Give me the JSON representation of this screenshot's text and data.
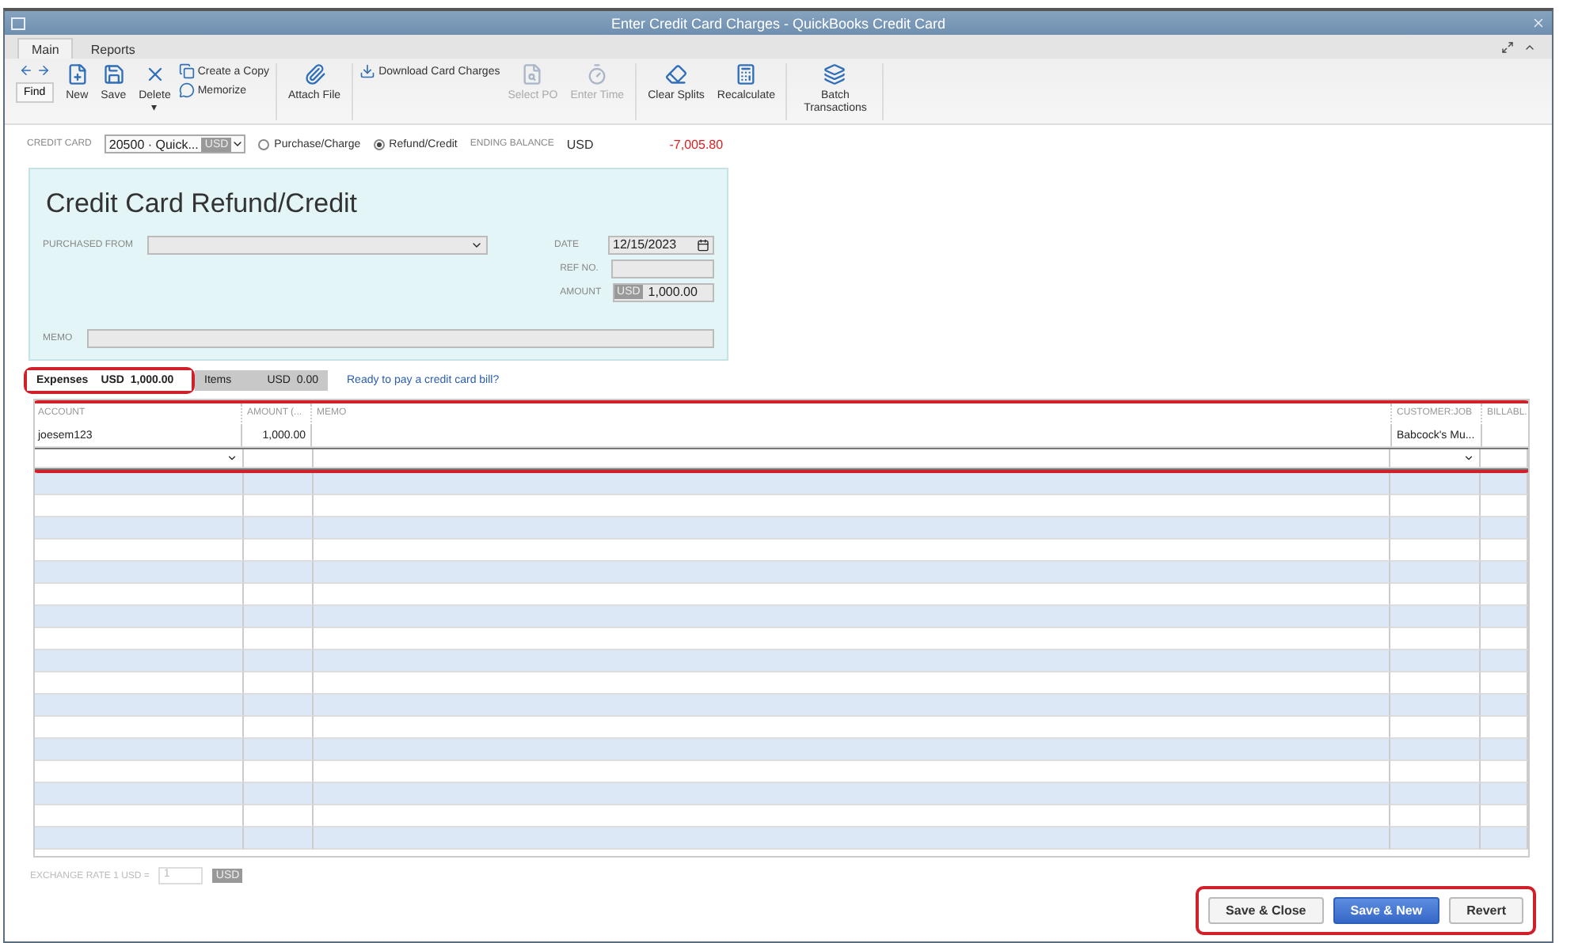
{
  "window": {
    "title": "Enter Credit Card Charges - QuickBooks Credit Card"
  },
  "ribbon_tabs": [
    {
      "label": "Main",
      "selected": true
    },
    {
      "label": "Reports",
      "selected": false
    }
  ],
  "toolbar": [
    {
      "kind": "find",
      "label": "Find"
    },
    {
      "kind": "big",
      "label": "New",
      "disabled": false
    },
    {
      "kind": "big",
      "label": "Save",
      "disabled": false
    },
    {
      "kind": "big",
      "label": "Delete",
      "disabled": false,
      "caret": "▾"
    },
    {
      "kind": "pair",
      "items": [
        {
          "label": "Create a Copy"
        },
        {
          "label": "Memorize"
        }
      ]
    },
    {
      "kind": "sep"
    },
    {
      "kind": "big",
      "label": "Attach File",
      "disabled": false
    },
    {
      "kind": "sep"
    },
    {
      "kind": "wide",
      "label": "Download Card Charges"
    },
    {
      "kind": "big",
      "label": "Select PO",
      "disabled": true
    },
    {
      "kind": "big",
      "label": "Enter Time",
      "disabled": true
    },
    {
      "kind": "sep"
    },
    {
      "kind": "big",
      "label": "Clear Splits",
      "disabled": false
    },
    {
      "kind": "big",
      "label": "Recalculate",
      "disabled": false
    },
    {
      "kind": "sep"
    },
    {
      "kind": "big",
      "label": "Batch Transactions",
      "disabled": false
    },
    {
      "kind": "sep"
    }
  ],
  "header": {
    "credit_card_label": "CREDIT CARD",
    "credit_card": "20500 · Quick...",
    "currency": "USD",
    "types": [
      {
        "label": "Purchase/Charge",
        "selected": false
      },
      {
        "label": "Refund/Credit",
        "selected": true
      }
    ],
    "ending_balance_label": "ENDING BALANCE",
    "ending_currency": "USD",
    "ending_balance": "-7,005.80"
  },
  "form": {
    "title": "Credit Card Refund/Credit",
    "purchased_from_label": "PURCHASED FROM",
    "date_label": "DATE",
    "date": "12/15/2023",
    "ref_label": "REF NO.",
    "amount_label": "AMOUNT",
    "amount_currency": "USD",
    "amount": "1,000.00",
    "memo_label": "MEMO"
  },
  "detail_tabs": [
    {
      "label": "Expenses",
      "total": "USD  1,000.00",
      "selected": true
    },
    {
      "label": "Items",
      "total": "USD  0.00",
      "selected": false
    }
  ],
  "bill_link": "Ready to pay a credit card bill?",
  "table": {
    "columns": [
      "ACCOUNT",
      "AMOUNT (...",
      "MEMO",
      "CUSTOMER:JOB",
      "BILLABL."
    ],
    "rows": [
      [
        "joesem123",
        "1,000.00",
        "",
        "Babcock's Mu...",
        ""
      ]
    ]
  },
  "exchange": {
    "label": "EXCHANGE RATE 1 USD =",
    "value": "1",
    "currency": "USD"
  },
  "buttons": [
    {
      "label": "Save & Close",
      "primary": false
    },
    {
      "label": "Save & New",
      "primary": true
    },
    {
      "label": "Revert",
      "primary": false
    }
  ]
}
